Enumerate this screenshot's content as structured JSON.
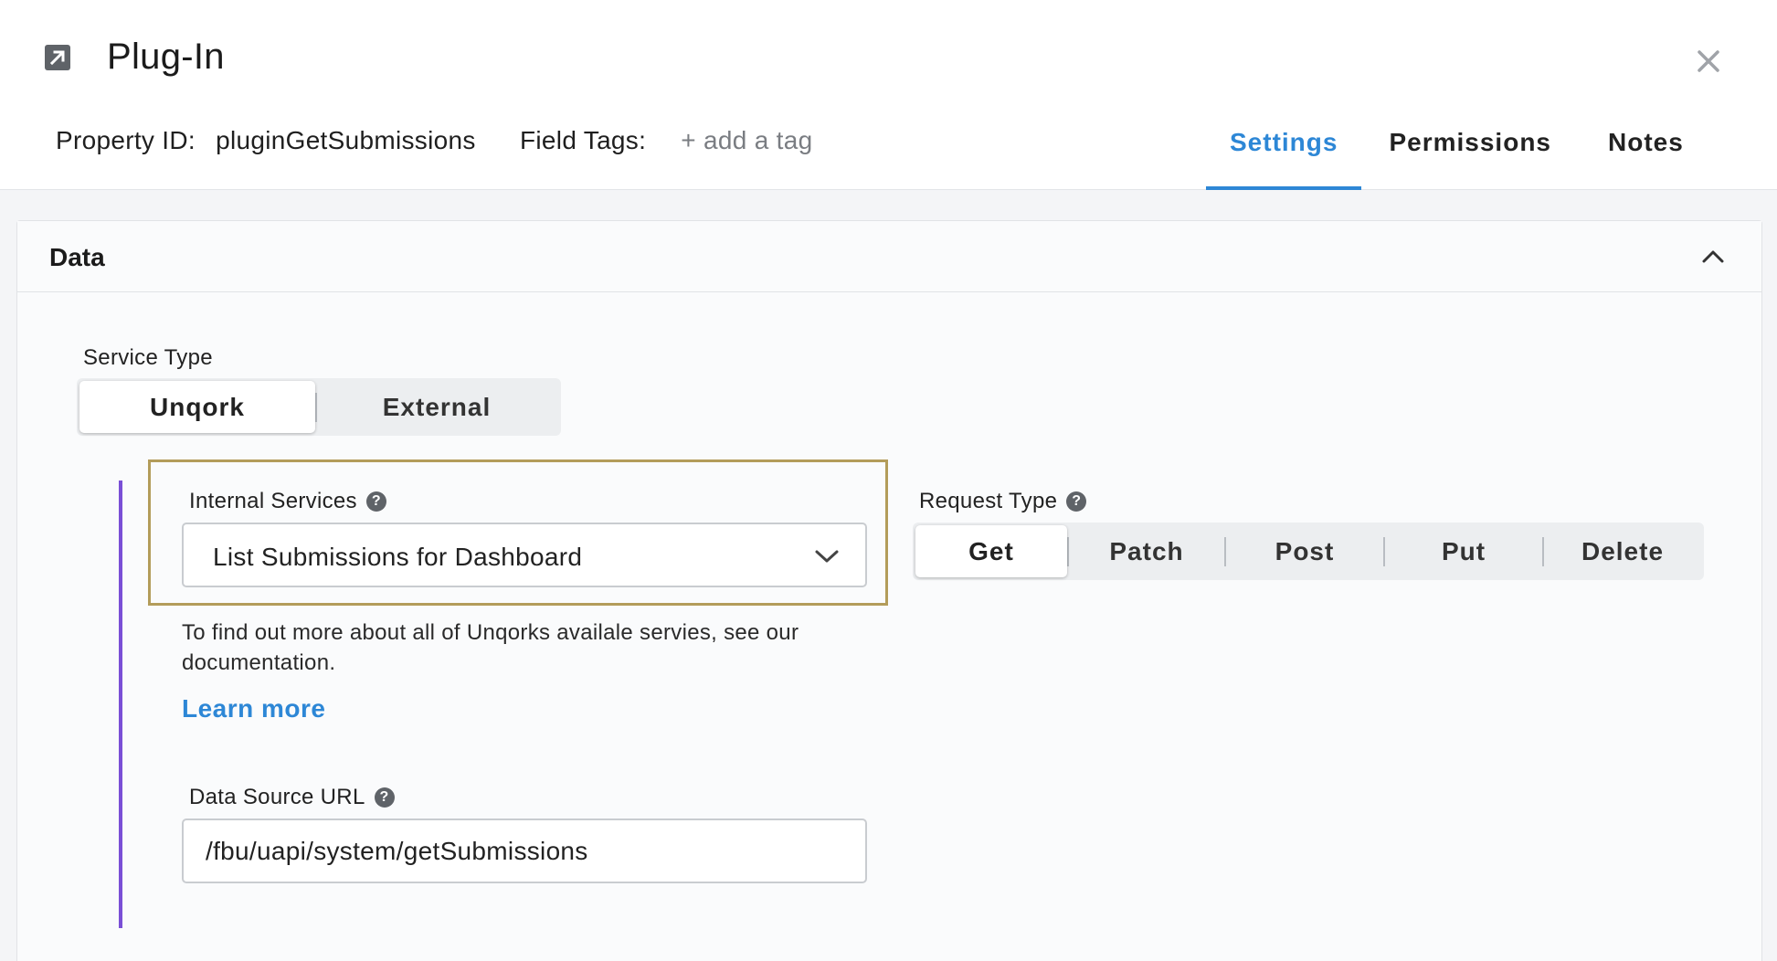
{
  "header": {
    "title": "Plug-In",
    "title_icon": "external-link-icon",
    "close_icon": "close-icon",
    "property_id_label": "Property ID:",
    "property_id_value": "pluginGetSubmissions",
    "field_tags_label": "Field Tags:",
    "add_tag_label": "+ add a tag"
  },
  "tabs": [
    {
      "label": "Settings",
      "active": true
    },
    {
      "label": "Permissions",
      "active": false
    },
    {
      "label": "Notes",
      "active": false
    }
  ],
  "panel": {
    "title": "Data",
    "collapse_icon": "chevron-up-icon"
  },
  "service_type": {
    "label": "Service Type",
    "options": [
      {
        "label": "Unqork",
        "active": true
      },
      {
        "label": "External",
        "active": false
      }
    ]
  },
  "internal_services": {
    "label": "Internal Services",
    "selected": "List Submissions for Dashboard"
  },
  "request_type": {
    "label": "Request Type",
    "options": [
      {
        "label": "Get",
        "active": true
      },
      {
        "label": "Patch",
        "active": false
      },
      {
        "label": "Post",
        "active": false
      },
      {
        "label": "Put",
        "active": false
      },
      {
        "label": "Delete",
        "active": false
      }
    ]
  },
  "help_text": "To find out more about all of Unqorks availale servies, see our documentation.",
  "learn_more": "Learn more",
  "data_source_url": {
    "label": "Data Source URL",
    "value": "/fbu/uapi/system/getSubmissions"
  },
  "colors": {
    "accent": "#2d87d6",
    "highlight_border": "#b39c5a",
    "indent_line": "#7a4fd6"
  }
}
